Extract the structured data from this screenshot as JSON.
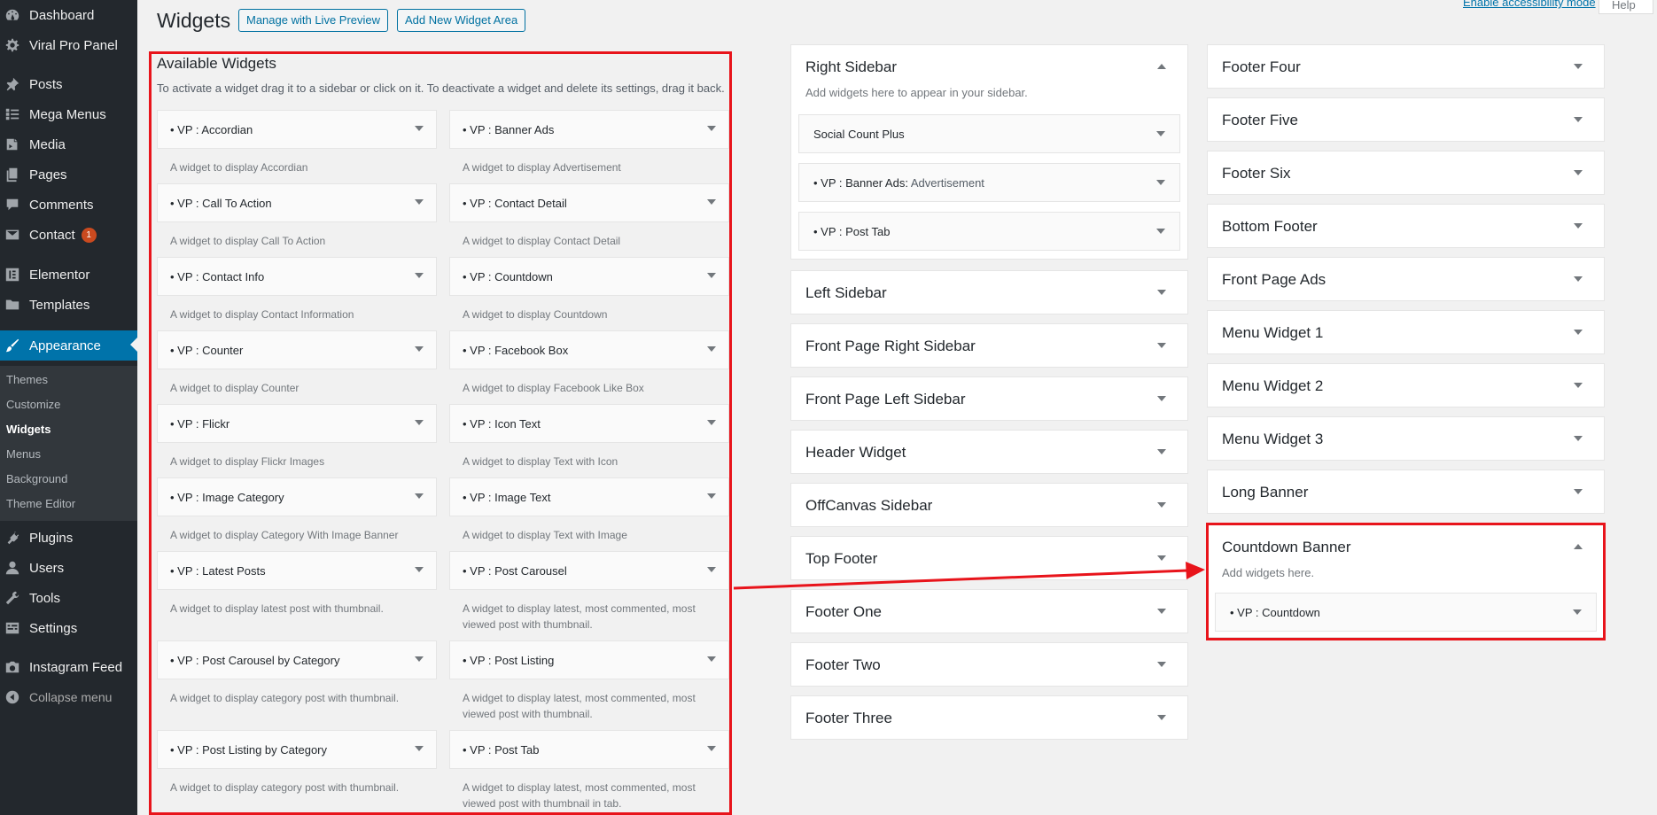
{
  "menu": {
    "items": [
      {
        "label": "Dashboard",
        "icon": "dashboard-icon"
      },
      {
        "label": "Viral Pro Panel",
        "icon": "gear-icon"
      },
      {
        "label": "Posts",
        "icon": "pin-icon"
      },
      {
        "label": "Mega Menus",
        "icon": "list-icon"
      },
      {
        "label": "Media",
        "icon": "media-icon"
      },
      {
        "label": "Pages",
        "icon": "pages-icon"
      },
      {
        "label": "Comments",
        "icon": "comment-icon"
      },
      {
        "label": "Contact",
        "icon": "mail-icon",
        "badge": "1"
      },
      {
        "label": "Elementor",
        "icon": "elementor-icon"
      },
      {
        "label": "Templates",
        "icon": "folder-icon"
      },
      {
        "label": "Appearance",
        "icon": "brush-icon"
      },
      {
        "label": "Plugins",
        "icon": "plug-icon"
      },
      {
        "label": "Users",
        "icon": "user-icon"
      },
      {
        "label": "Tools",
        "icon": "wrench-icon"
      },
      {
        "label": "Settings",
        "icon": "settings-icon"
      },
      {
        "label": "Instagram Feed",
        "icon": "camera-icon"
      },
      {
        "label": "Collapse menu",
        "icon": "collapse-icon"
      }
    ],
    "submenu": [
      "Themes",
      "Customize",
      "Widgets",
      "Menus",
      "Background",
      "Theme Editor"
    ],
    "current_item": "Appearance",
    "current_sub": "Widgets"
  },
  "header": {
    "title": "Widgets",
    "manage_live_preview": "Manage with Live Preview",
    "add_widget_area": "Add New Widget Area",
    "accessibility_link": "Enable accessibility mode",
    "help": "Help"
  },
  "available": {
    "title": "Available Widgets",
    "description": "To activate a widget drag it to a sidebar or click on it. To deactivate a widget and delete its settings, drag it back.",
    "widgets": [
      {
        "title": "• VP : Accordian",
        "desc": "A widget to display Accordian"
      },
      {
        "title": "• VP : Banner Ads",
        "desc": "A widget to display Advertisement"
      },
      {
        "title": "• VP : Call To Action",
        "desc": "A widget to display Call To Action"
      },
      {
        "title": "• VP : Contact Detail",
        "desc": "A widget to display Contact Detail"
      },
      {
        "title": "• VP : Contact Info",
        "desc": "A widget to display Contact Information"
      },
      {
        "title": "• VP : Countdown",
        "desc": "A widget to display Countdown"
      },
      {
        "title": "• VP : Counter",
        "desc": "A widget to display Counter"
      },
      {
        "title": "• VP : Facebook Box",
        "desc": "A widget to display Facebook Like Box"
      },
      {
        "title": "• VP : Flickr",
        "desc": "A widget to display Flickr Images"
      },
      {
        "title": "• VP : Icon Text",
        "desc": "A widget to display Text with Icon"
      },
      {
        "title": "• VP : Image Category",
        "desc": "A widget to display Category With Image Banner"
      },
      {
        "title": "• VP : Image Text",
        "desc": "A widget to display Text with Image"
      },
      {
        "title": "• VP : Latest Posts",
        "desc": "A widget to display latest post with thumbnail."
      },
      {
        "title": "• VP : Post Carousel",
        "desc": "A widget to display latest, most commented, most viewed post with thumbnail."
      },
      {
        "title": "• VP : Post Carousel by Category",
        "desc": "A widget to display category post with thumbnail."
      },
      {
        "title": "• VP : Post Listing",
        "desc": "A widget to display latest, most commented, most viewed post with thumbnail."
      },
      {
        "title": "• VP : Post Listing by Category",
        "desc": "A widget to display category post with thumbnail."
      },
      {
        "title": "• VP : Post Tab",
        "desc": "A widget to display latest, most commented, most viewed post with thumbnail in tab."
      }
    ]
  },
  "right_sidebar": {
    "title": "Right Sidebar",
    "description": "Add widgets here to appear in your sidebar.",
    "widgets": [
      {
        "title": "Social Count Plus",
        "sub": ""
      },
      {
        "title": "• VP : Banner Ads:",
        "sub": " Advertisement"
      },
      {
        "title": "• VP : Post Tab",
        "sub": ""
      }
    ]
  },
  "middle_sidebars": [
    "Left Sidebar",
    "Front Page Right Sidebar",
    "Front Page Left Sidebar",
    "Header Widget",
    "OffCanvas Sidebar",
    "Top Footer",
    "Footer One",
    "Footer Two",
    "Footer Three"
  ],
  "right_column_sidebars": [
    "Footer Four",
    "Footer Five",
    "Footer Six",
    "Bottom Footer",
    "Front Page Ads",
    "Menu Widget 1",
    "Menu Widget 2",
    "Menu Widget 3",
    "Long Banner"
  ],
  "countdown_banner": {
    "title": "Countdown Banner",
    "description": "Add widgets here.",
    "widget": "• VP : Countdown"
  },
  "colors": {
    "admin_bg": "#23282d",
    "submenu_bg": "#32373c",
    "accent": "#0073aa",
    "annotation_red": "#e8141b"
  }
}
